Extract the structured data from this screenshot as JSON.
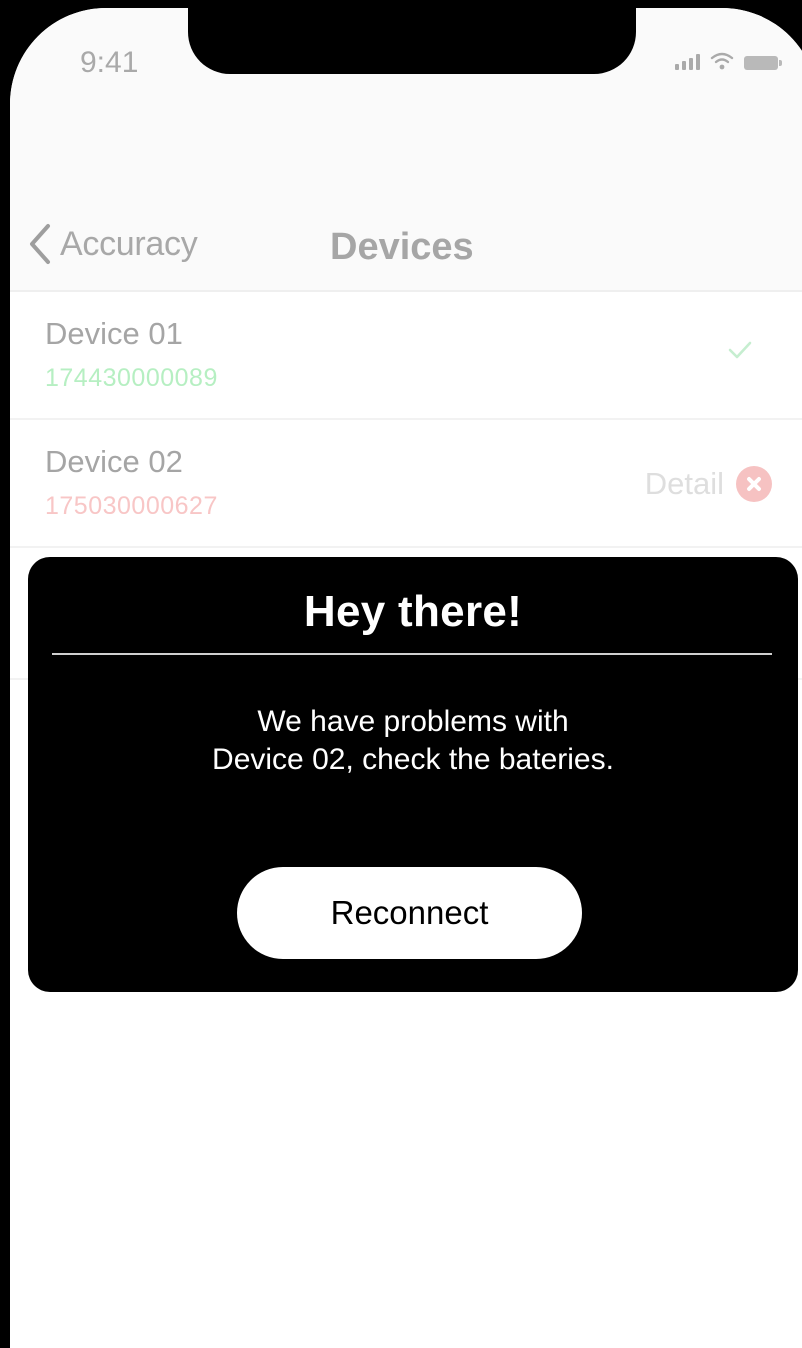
{
  "status_bar": {
    "time": "9:41",
    "icons": [
      "signal-icon",
      "wifi-icon",
      "battery-icon"
    ]
  },
  "nav": {
    "back_label": "Accuracy",
    "back_icon": "chevron-left-icon",
    "title": "Devices"
  },
  "devices": [
    {
      "name": "Device 01",
      "serial": "174430000089",
      "serial_color": "#b6efc2",
      "status": "connected",
      "status_icon": "check-icon",
      "status_color": "#c6eed0"
    },
    {
      "name": "Device 02",
      "serial": "175030000627",
      "serial_color": "#f8c6c6",
      "status": "error",
      "detail_label": "Detail",
      "status_icon": "error-icon",
      "status_color": "#f6c2c2"
    }
  ],
  "modal": {
    "title": "Hey there!",
    "message_line1": "We have problems with",
    "message_line2": "Device 02, check the bateries.",
    "button_label": "Reconnect"
  },
  "colors": {
    "background": "#000000",
    "screen": "#ffffff",
    "modal": "#000000",
    "muted_text": "#a6a6a6"
  }
}
